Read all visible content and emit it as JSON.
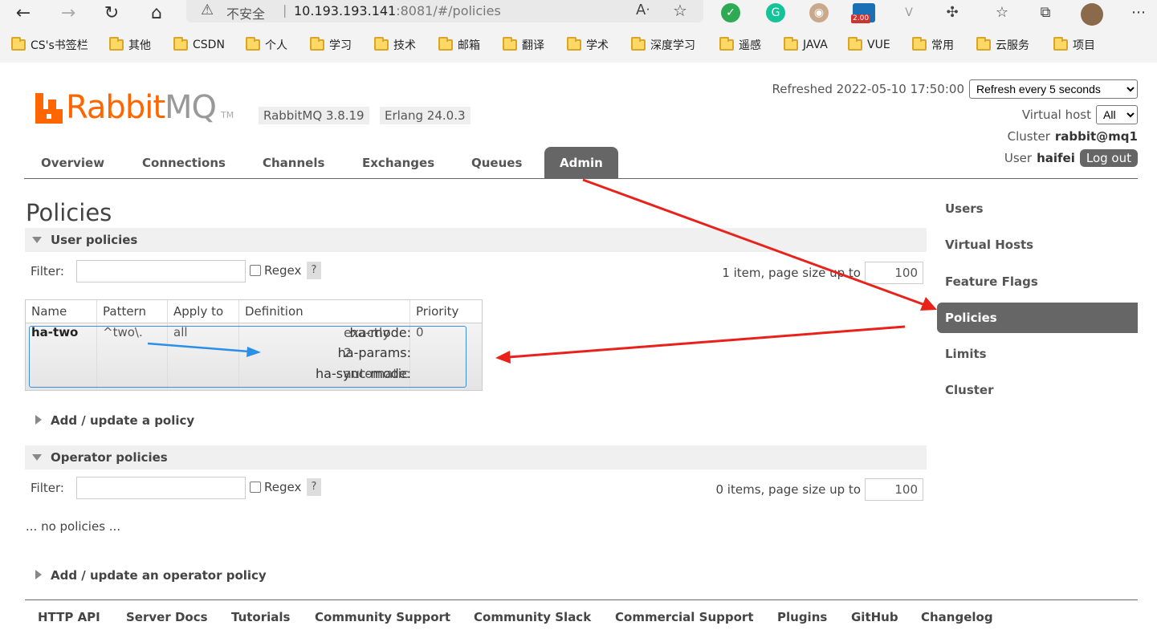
{
  "browser": {
    "insecure_label": "不安全",
    "url_host": "10.193.193.141",
    "url_rest": ":8081/#/policies",
    "ext_badge": "2.00",
    "bookmarks": [
      "CS's书签栏",
      "其他",
      "CSDN",
      "个人",
      "学习",
      "技术",
      "邮箱",
      "翻译",
      "学术",
      "深度学习",
      "遥感",
      "JAVA",
      "VUE",
      "常用",
      "云服务",
      "项目"
    ]
  },
  "header": {
    "logo_rabbit": "Rabbit",
    "logo_mq": "MQ",
    "logo_tm": "TM",
    "rabbitmq_version": "RabbitMQ 3.8.19",
    "erlang_version": "Erlang 24.0.3",
    "refreshed_label": "Refreshed 2022-05-10 17:50:00",
    "refresh_select": "Refresh every 5 seconds",
    "vhost_label": "Virtual host",
    "vhost_value": "All",
    "cluster_label": "Cluster",
    "cluster_value": "rabbit@mq1",
    "user_label": "User",
    "user_value": "haifei",
    "logout": "Log out"
  },
  "nav": {
    "tabs": [
      "Overview",
      "Connections",
      "Channels",
      "Exchanges",
      "Queues",
      "Admin"
    ],
    "active": "Admin"
  },
  "page_title": "Policies",
  "user_policies": {
    "heading": "User policies",
    "filter_label": "Filter:",
    "regex_label": "Regex",
    "help": "?",
    "paging_text": "1 item, page size up to",
    "page_size": "100",
    "columns": [
      "Name",
      "Pattern",
      "Apply to",
      "Definition",
      "Priority"
    ],
    "rows": [
      {
        "name": "ha-two",
        "pattern": "^two\\.",
        "apply_to": "all",
        "definition": [
          {
            "key": "ha-mode:",
            "value": "exactly"
          },
          {
            "key": "ha-params:",
            "value": "2"
          },
          {
            "key": "ha-sync-mode:",
            "value": "automatic"
          }
        ],
        "priority": "0"
      }
    ]
  },
  "add_policy": "Add / update a policy",
  "operator_policies": {
    "heading": "Operator policies",
    "filter_label": "Filter:",
    "regex_label": "Regex",
    "help": "?",
    "paging_text": "0 items, page size up to",
    "page_size": "100",
    "empty_text": "... no policies ..."
  },
  "add_operator_policy": "Add / update an operator policy",
  "sidebar": {
    "items": [
      "Users",
      "Virtual Hosts",
      "Feature Flags",
      "Policies",
      "Limits",
      "Cluster"
    ],
    "active": "Policies"
  },
  "footer": {
    "links": [
      "HTTP API",
      "Server Docs",
      "Tutorials",
      "Community Support",
      "Community Slack",
      "Commercial Support",
      "Plugins",
      "GitHub",
      "Changelog"
    ]
  },
  "colors": {
    "brand_orange": "#ff6600",
    "nav_active": "#666666",
    "annotation_red": "#e8221b",
    "annotation_blue": "#2b8fe8"
  }
}
